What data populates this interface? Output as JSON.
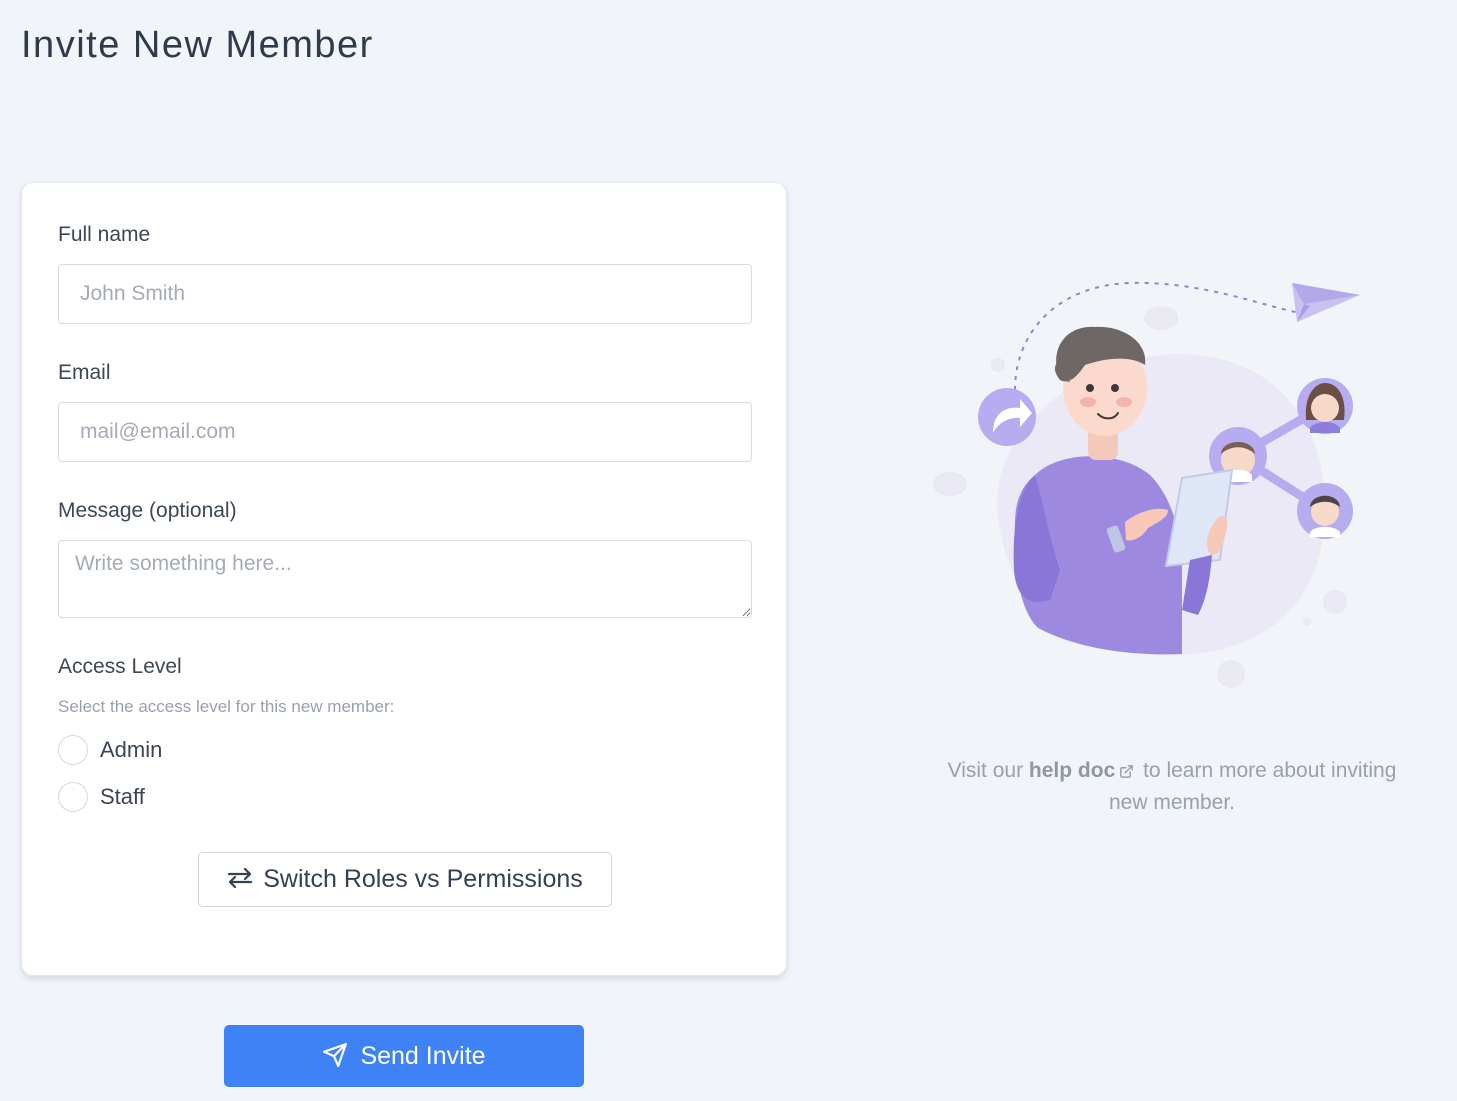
{
  "page": {
    "title": "Invite New Member"
  },
  "form": {
    "full_name": {
      "label": "Full name",
      "placeholder": "John Smith",
      "value": ""
    },
    "email": {
      "label": "Email",
      "placeholder": "mail@email.com",
      "value": ""
    },
    "message": {
      "label": "Message (optional)",
      "placeholder": "Write something here...",
      "value": ""
    },
    "access": {
      "label": "Access Level",
      "hint": "Select the access level for this new member:",
      "options": [
        {
          "label": "Admin",
          "selected": false
        },
        {
          "label": "Staff",
          "selected": false
        }
      ]
    },
    "switch_button": {
      "label": "Switch Roles vs Permissions",
      "icon": "arrows-exchange-icon"
    }
  },
  "send_button": {
    "label": "Send Invite",
    "icon": "paper-plane-icon"
  },
  "help": {
    "prefix": "Visit our",
    "link_text": "help doc",
    "link_icon": "external-link-icon",
    "suffix": "to learn more about inviting new member."
  },
  "colors": {
    "background": "#f1f4f9",
    "primary": "#3e82f6",
    "illustration_purple": "#8f7ddb"
  }
}
